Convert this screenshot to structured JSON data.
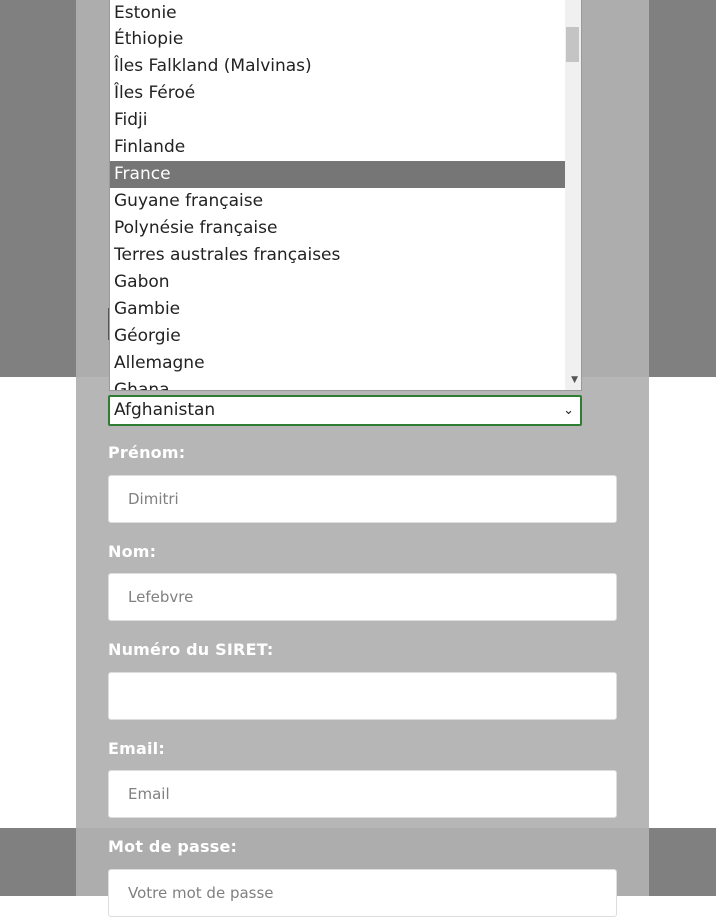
{
  "dropdown": {
    "options": [
      "Estonie",
      "Éthiopie",
      "Îles Falkland (Malvinas)",
      "Îles Féroé",
      "Fidji",
      "Finlande",
      "France",
      "Guyane française",
      "Polynésie française",
      "Terres australes françaises",
      "Gabon",
      "Gambie",
      "Géorgie",
      "Allemagne",
      "Ghana"
    ],
    "highlighted": "France",
    "scroll_down_glyph": "▼"
  },
  "country_select": {
    "value": "Afghanistan",
    "chevron": "⌄"
  },
  "form": {
    "prenom_label": "Prénom:",
    "prenom_value": "Dimitri",
    "nom_label": "Nom:",
    "nom_value": "Lefebvre",
    "siret_label": "Numéro du SIRET:",
    "siret_value": "",
    "email_label": "Email:",
    "email_placeholder": "Email",
    "password_label": "Mot de passe:",
    "password_placeholder": "Votre mot de passe"
  },
  "colors": {
    "overlay": "#808080",
    "card": "#b6b6b6",
    "highlight": "#767676",
    "select_border": "#2e7d32"
  }
}
